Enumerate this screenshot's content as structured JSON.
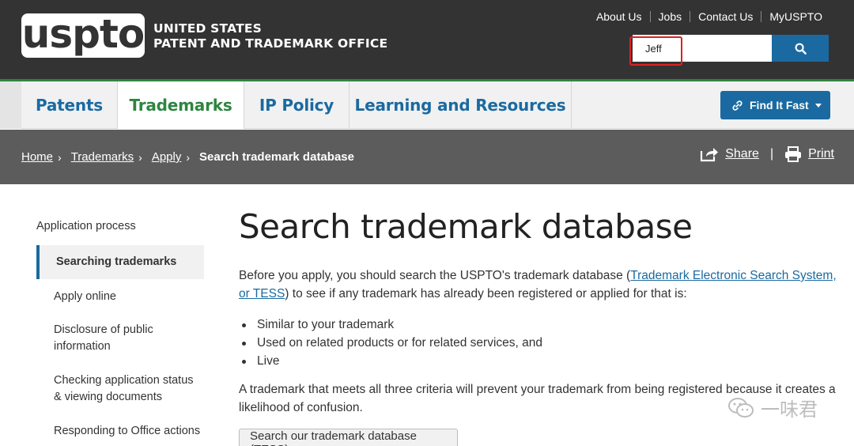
{
  "header": {
    "logo_text": "uspto",
    "agency_line1": "UNITED STATES",
    "agency_line2": "PATENT AND TRADEMARK OFFICE",
    "util_links": [
      "About Us",
      "Jobs",
      "Contact Us",
      "MyUSPTO"
    ],
    "search_value": "Jeff",
    "search_icon": "search-icon",
    "highlight_color": "#e02020"
  },
  "nav": {
    "tabs": [
      "Patents",
      "Trademarks",
      "IP Policy",
      "Learning and Resources"
    ],
    "active_tab": "Trademarks",
    "find_it_fast": "Find It Fast"
  },
  "breadcrumb": {
    "items": [
      "Home",
      "Trademarks",
      "Apply"
    ],
    "current": "Search trademark database",
    "share": "Share",
    "print": "Print"
  },
  "sidebar": {
    "heading": "Application process",
    "items": [
      "Searching trademarks",
      "Apply online",
      "Disclosure of public information",
      "Checking application status & viewing documents",
      "Responding to Office actions"
    ],
    "active_item": "Searching trademarks"
  },
  "main": {
    "title": "Search trademark database",
    "intro_before": "Before you apply, you should search the USPTO's trademark database (",
    "intro_link": "Trademark Electronic Search System, or TESS",
    "intro_after": ") to see if any trademark has already been registered or applied for that is:",
    "bullets": [
      "Similar to your trademark",
      "Used on related products or for related services, and",
      "Live"
    ],
    "paragraph2": "A trademark that meets all three criteria will prevent your trademark from being registered because it creates a likelihood of confusion.",
    "button_label": "Search our trademark database (TESS)"
  },
  "watermark": {
    "text": "一味君"
  },
  "colors": {
    "header_bg": "#333333",
    "brand_blue": "#1a6aa1",
    "brand_green": "#2e8540",
    "crumb_bg": "#5c5c5c"
  }
}
